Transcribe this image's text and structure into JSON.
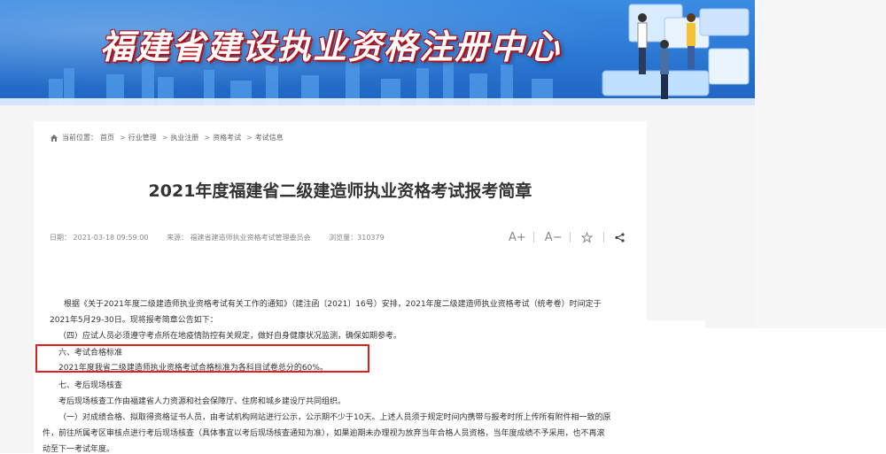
{
  "banner": {
    "title": "福建省建设执业资格注册中心"
  },
  "breadcrumb": {
    "prefix": "当前位置：",
    "items": [
      "首页",
      "行业管理",
      "执业注册",
      "资格考试",
      "考试信息"
    ],
    "separator": ">"
  },
  "article": {
    "title": "2021年度福建省二级建造师执业资格考试报考简章",
    "date": "日期： 2021-03-18 09:59:00",
    "source": "来源： 福建省建造师执业资格考试管理委员会",
    "views": "浏览量：310379",
    "tools": {
      "font_increase": "A+",
      "font_decrease": "A−"
    },
    "paragraphs": [
      "根据《关于2021年度二级建造师执业资格考试有关工作的通知》（建注函〔2021〕16号）安排，2021年度二级建造师执业资格考试（统考卷）时间定于",
      "2021年5月29-30日。现将报考简章公告如下：",
      "（四）应试人员必须遵守考点所在地疫情防控有关规定，做好自身健康状况监测，确保如期参考。",
      "六、考试合格标准",
      "2021年度我省二级建造师执业资格考试合格标准为各科目试卷总分的60%。",
      "七、考后现场核查",
      "考后现场核查工作由福建省人力资源和社会保障厅、住房和城乡建设厅共同组织。",
      "（一）对成绩合格、拟取得资格证书人员，由考试机构网站进行公示，公示期不少于10天。上述人员须于规定时间内携带与报考时所上传所有附件相一致的原",
      "件，前往所属考区审核点进行考后现场核查（具体事宜以考后现场核查通知为准），如果逾期未办理视为放弃当年合格人员资格，当年度成绩不予采用，也不再滚",
      "动至下一考试年度。"
    ]
  },
  "colors": {
    "banner": "#2d7bd6",
    "highlight": "#e02020",
    "title_stroke": "#b0101a"
  },
  "icons": [
    "home-icon",
    "star-icon",
    "share-icon"
  ]
}
